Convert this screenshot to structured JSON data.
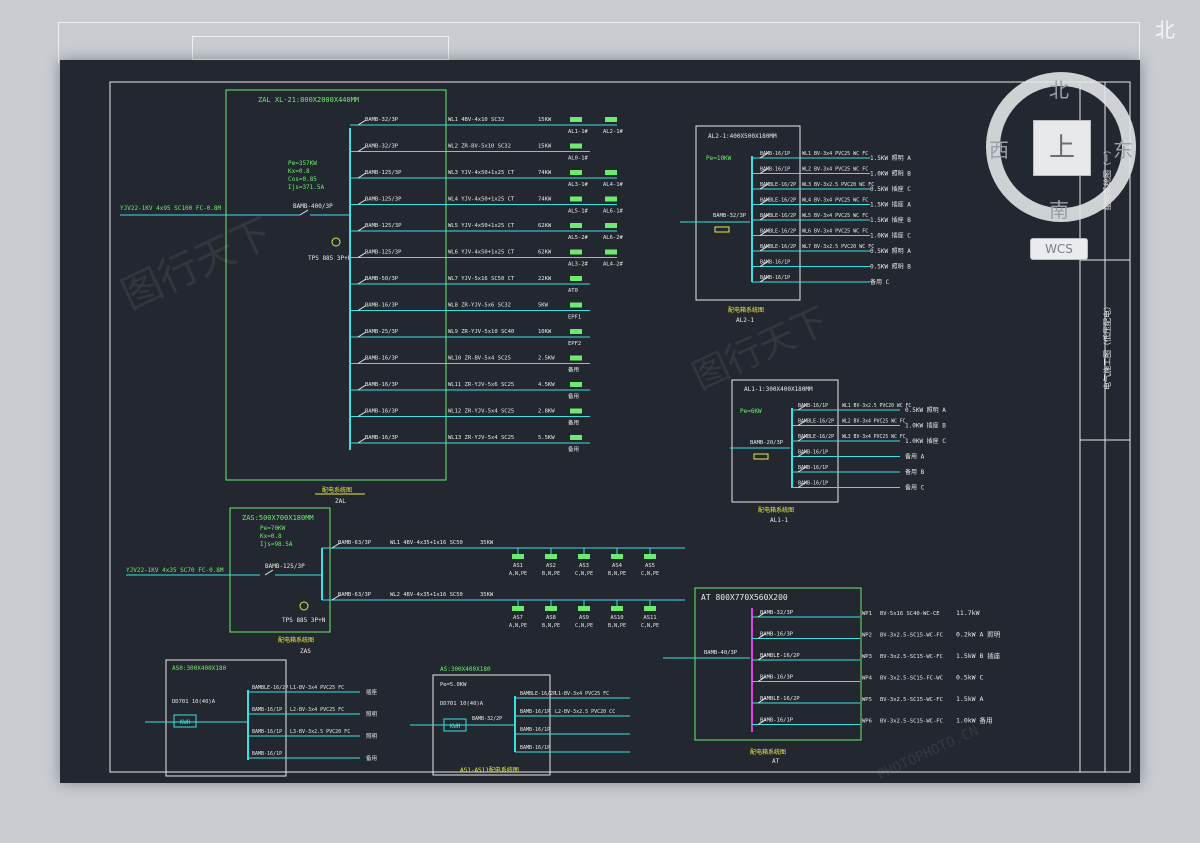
{
  "viewcube": {
    "north": "北",
    "south": "南",
    "east": "东",
    "west": "西",
    "face": "上",
    "wcs": "WCS",
    "north_outer": "北"
  },
  "colors": {
    "canvas": "#232830",
    "cyan": "#3de0e0",
    "green": "#6eea6e",
    "magenta": "#e040e0",
    "yellow": "#e8e84a",
    "white": "#e8e8e8"
  },
  "ZAL": {
    "title": "ZAL XL-21:800X2000X440MM",
    "caption": "配电系统图",
    "sub": "ZAL",
    "incoming": "YJV22-1KV 4x95 SC100 FC-0.8M",
    "params": [
      "Pe=357KW",
      "Kx=0.8",
      "Cos=0.85",
      "Ijs=371.5A"
    ],
    "main_breaker": "BAMB-400/3P",
    "meter": "TPS 885 3P+N",
    "circuits": [
      {
        "breaker": "BAMB-32/3P",
        "cable": "WL1 4BV-4x10 SC32",
        "kw": "15KW",
        "loads": [
          "AL1-1#",
          "AL2-1#"
        ]
      },
      {
        "breaker": "BAMB-32/3P",
        "cable": "WL2 ZR-BV-5x10 SC32",
        "kw": "15KW",
        "loads": [
          "AL0-1#"
        ]
      },
      {
        "breaker": "BAMB-125/3P",
        "cable": "WL3 YJV-4x50+1x25 CT",
        "kw": "74KW",
        "loads": [
          "AL3-1#",
          "AL4-1#"
        ]
      },
      {
        "breaker": "BAMB-125/3P",
        "cable": "WL4 YJV-4x50+1x25 CT",
        "kw": "74KW",
        "loads": [
          "AL5-1#",
          "AL6-1#"
        ]
      },
      {
        "breaker": "BAMB-125/3P",
        "cable": "WL5 YJV-4x50+1x25 CT",
        "kw": "62KW",
        "loads": [
          "AL5-2#",
          "AL6-2#"
        ]
      },
      {
        "breaker": "BAMB-125/3P",
        "cable": "WL6 YJV-4x50+1x25 CT",
        "kw": "62KW",
        "loads": [
          "AL3-2#",
          "AL4-2#"
        ]
      },
      {
        "breaker": "BAMB-50/3P",
        "cable": "WL7 YJV-5x16 SC50 CT",
        "kw": "22KW",
        "loads": [
          "AT0"
        ]
      },
      {
        "breaker": "BAMB-16/3P",
        "cable": "WL8 ZR-YJV-5x6 SC32",
        "kw": "5KW",
        "loads": [
          "EPF1"
        ]
      },
      {
        "breaker": "BAMB-25/3P",
        "cable": "WL9 ZR-YJV-5x10 SC40",
        "kw": "10KW",
        "loads": [
          "EPF2"
        ]
      },
      {
        "breaker": "BAMB-16/3P",
        "cable": "WL10 ZR-BV-5x4 SC25",
        "kw": "2.5KW",
        "loads": [
          "备用"
        ]
      },
      {
        "breaker": "BAMB-16/3P",
        "cable": "WL11 ZR-YJV-5x6 SC25",
        "kw": "4.5KW",
        "loads": [
          "备用"
        ]
      },
      {
        "breaker": "BAMB-16/3P",
        "cable": "WL12 ZR-YJV-5x4 SC25",
        "kw": "2.8KW",
        "loads": [
          "备用"
        ]
      },
      {
        "breaker": "BAMB-16/3P",
        "cable": "WL13 ZR-YJV-5x4 SC25",
        "kw": "5.5KW",
        "loads": [
          "备用"
        ]
      }
    ]
  },
  "AL2": {
    "title": "AL2-1:400X500X180MM",
    "caption": "配电箱系统图",
    "sub": "AL2-1",
    "params": "Pe=10KW",
    "main_breaker": "BAMB-32/3P",
    "rows": [
      {
        "breaker": "BAMB-16/1P",
        "cable": "WL1 BV-3x4 PVC25 WC FC",
        "load": "1.5KW 照明 A"
      },
      {
        "breaker": "BAMB-16/1P",
        "cable": "WL2 BV-3x4 PVC25 WC FC",
        "load": "1.0KW 照明 B"
      },
      {
        "breaker": "BAMBLE-16/2P",
        "cable": "WL3 BV-3x2.5 PVC20 WC FC",
        "load": "0.5KW 插座 C"
      },
      {
        "breaker": "BAMBLE-16/2P",
        "cable": "WL4 BV-3x4 PVC25 WC FC",
        "load": "1.5KW 插座 A"
      },
      {
        "breaker": "BAMBLE-16/2P",
        "cable": "WL5 BV-3x4 PVC25 WC FC",
        "load": "1.5KW 插座 B"
      },
      {
        "breaker": "BAMBLE-16/2P",
        "cable": "WL6 BV-3x4 PVC25 WC FC",
        "load": "1.0KW 插座 C"
      },
      {
        "breaker": "BAMBLE-16/2P",
        "cable": "WL7 BV-3x2.5 PVC20 WC FC",
        "load": "0.5KW 照明 A"
      },
      {
        "breaker": "BAMB-16/1P",
        "cable": "",
        "load": "0.5KW 照明 B"
      },
      {
        "breaker": "BAMB-16/1P",
        "cable": "",
        "load": "备用 C"
      }
    ]
  },
  "AL1": {
    "title": "AL1-1:300X400X180MM",
    "caption": "配电箱系统图",
    "sub": "AL1-1",
    "params": "Pe=6KW",
    "main_breaker": "BAMB-20/3P",
    "rows": [
      {
        "breaker": "BAMB-16/1P",
        "cable": "WL1 BV-3x2.5 PVC20 WC FC",
        "load": "0.5KW 照明 A"
      },
      {
        "breaker": "BAMBLE-16/2P",
        "cable": "WL2 BV-3x4 PVC25 WC FC",
        "load": "1.0KW 插座 B"
      },
      {
        "breaker": "BAMBLE-16/2P",
        "cable": "WL3 BV-3x4 PVC25 WC FC",
        "load": "1.0KW 插座 C"
      },
      {
        "breaker": "BAMB-16/1P",
        "cable": "",
        "load": "备用 A"
      },
      {
        "breaker": "BAMB-16/1P",
        "cable": "",
        "load": "备用 B"
      },
      {
        "breaker": "BAMB-16/1P",
        "cable": "",
        "load": "备用 C"
      }
    ]
  },
  "ZAS": {
    "title": "ZAS:500X700X180MM",
    "caption": "配电箱系统图",
    "sub": "ZAS",
    "incoming": "YJV22-1KV 4x35 SC70 FC-0.8M",
    "params": [
      "Pe=70KW",
      "Kx=0.8",
      "Ijs=98.5A"
    ],
    "main_breaker": "BAMB-125/3P",
    "meter": "TPS 885 3P+N",
    "circuits": [
      {
        "breaker": "BAMB-63/3P",
        "cable": "WL1 4BV-4x35+1x16 SC50",
        "kw": "35KW",
        "loads": [
          {
            "id": "AS1",
            "sub": "A,N,PE"
          },
          {
            "id": "AS2",
            "sub": "B,N,PE"
          },
          {
            "id": "AS3",
            "sub": "C,N,PE"
          },
          {
            "id": "AS4",
            "sub": "B,N,PE"
          },
          {
            "id": "AS5",
            "sub": "C,N,PE"
          }
        ]
      },
      {
        "breaker": "BAMB-63/3P",
        "cable": "WL2 4BV-4x35+1x16 SC50",
        "kw": "35KW",
        "loads": [
          {
            "id": "AS7",
            "sub": "A,N,PE"
          },
          {
            "id": "AS8",
            "sub": "B,N,PE"
          },
          {
            "id": "AS9",
            "sub": "C,N,PE"
          },
          {
            "id": "AS10",
            "sub": "B,N,PE"
          },
          {
            "id": "AS11",
            "sub": "C,N,PE"
          }
        ]
      }
    ]
  },
  "AT": {
    "title": "AT 800X770X560X200",
    "caption": "配电箱系统图",
    "sub": "AT",
    "main_breaker": "BAMB-40/3P",
    "rows": [
      {
        "breaker": "BAMB-32/3P",
        "code": "WP1",
        "cable": "BV-5x16 SC40-WC-CE",
        "load": "11.7kW"
      },
      {
        "breaker": "BAMB-16/3P",
        "code": "WP2",
        "cable": "BV-3x2.5-SC15-WC-FC",
        "load": "0.2kW A 照明"
      },
      {
        "breaker": "BAMBLE-16/2P",
        "code": "WP3",
        "cable": "BV-3x2.5-SC15-WC-FC",
        "load": "1.5kW B 插座"
      },
      {
        "breaker": "BAMB-16/3P",
        "code": "WP4",
        "cable": "BV-3x2.5-SC15-FC-WC",
        "load": "0.5kW C"
      },
      {
        "breaker": "BAMBLE-16/2P",
        "code": "WP5",
        "cable": "BV-3x2.5-SC15-WC-FC",
        "load": "1.5kW A"
      },
      {
        "breaker": "BAMB-16/1P",
        "code": "WP6",
        "cable": "BV-3x2.5-SC15-WC-FC",
        "load": "1.0kW 备用"
      }
    ]
  },
  "AS0": {
    "title": "AS0:300X400X180",
    "meter": "KWH",
    "meter_label": "DD701 10(40)A",
    "rows": [
      {
        "breaker": "BAMBLE-16/2P",
        "cable": "L1-BV-3x4 PVC25 FC",
        "load": "插座"
      },
      {
        "breaker": "BAMB-16/1P",
        "cable": "L2-BV-3x4 PVC25 FC",
        "load": "照明"
      },
      {
        "breaker": "BAMB-16/1P",
        "cable": "L3-BV-3x2.5 PVC20 FC",
        "load": "照明"
      },
      {
        "breaker": "BAMB-16/1P",
        "cable": "",
        "load": "备用"
      }
    ]
  },
  "AS": {
    "title": "AS:300X400X180",
    "params": "Pe=5.0KW",
    "meter": "KWH",
    "meter_label": "DD701 10(40)A",
    "main_breaker": "BAMB-32/2P",
    "caption": "AS1-AS11配电系统图",
    "rows": [
      {
        "breaker": "BAMBLE-16/2P",
        "cable": "L1-BV-3x4 PVC25 FC",
        "load": ""
      },
      {
        "breaker": "BAMB-16/1P",
        "cable": "L2-BV-3x2.5 PVC20 CC",
        "load": ""
      },
      {
        "breaker": "BAMB-16/1P",
        "cable": "",
        "load": ""
      },
      {
        "breaker": "BAMB-16/1P",
        "cable": "",
        "load": ""
      }
    ]
  },
  "title_block": {
    "drawing_name": "配电系统图（一）",
    "project": "电气施工图（低压配电）"
  },
  "watermark": {
    "brand": "图行天下",
    "sub": "PHOTOPHOTO.CN"
  }
}
